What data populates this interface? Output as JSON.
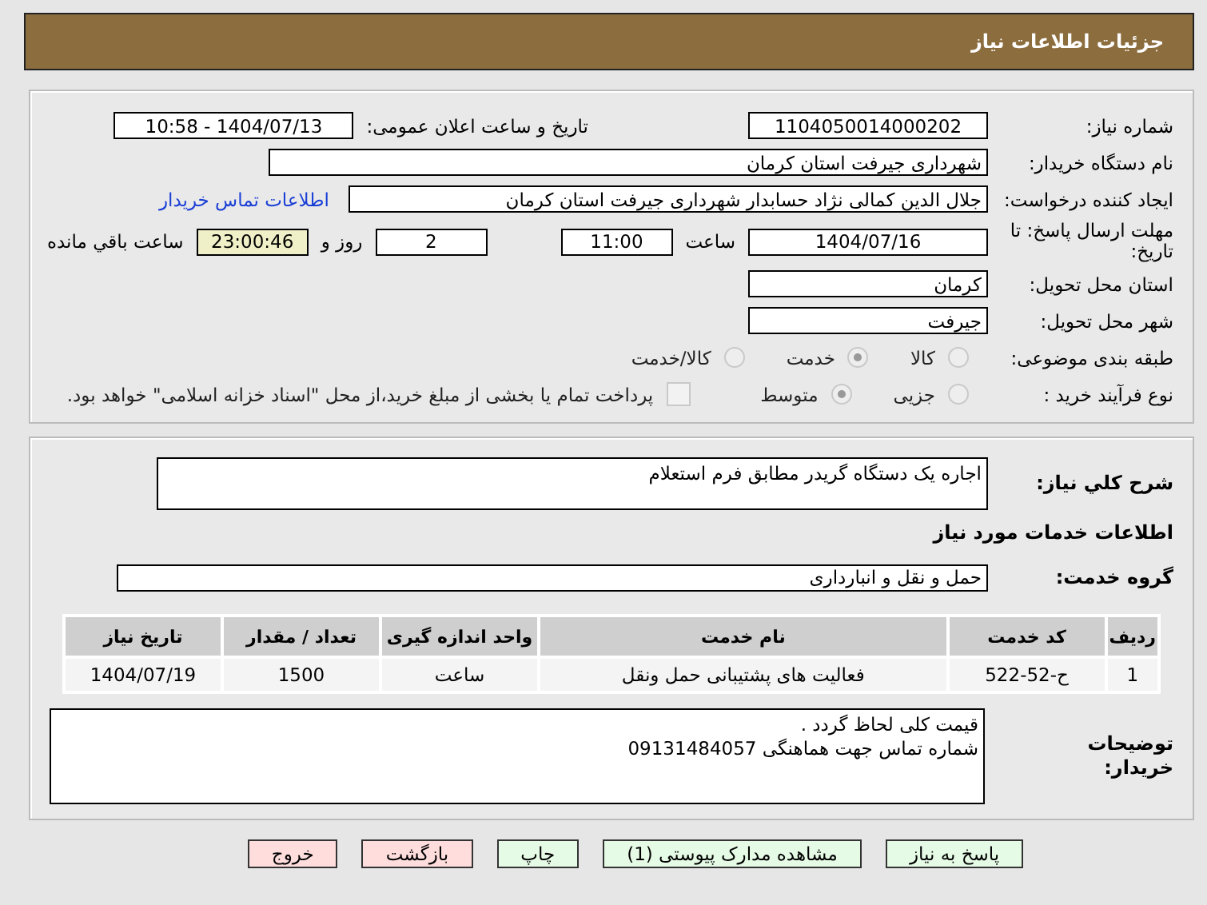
{
  "header": {
    "title": "جزئیات اطلاعات نیاز"
  },
  "need_number": {
    "label": "شماره نیاز:",
    "value": "1104050014000202"
  },
  "announce": {
    "label": "تاریخ و ساعت اعلان عمومی:",
    "value": "1404/07/13 - 10:58"
  },
  "buyer_org": {
    "label": "نام دستگاه خریدار:",
    "value": "شهرداری جیرفت استان کرمان"
  },
  "creator": {
    "label": "ایجاد کننده درخواست:",
    "value": "جلال الدین کمالی نژاد حسابدار شهرداری جیرفت استان کرمان",
    "link": "اطلاعات تماس خریدار"
  },
  "deadline": {
    "label": "مهلت ارسال پاسخ: تا تاریخ:",
    "date": "1404/07/16",
    "time_label": "ساعت",
    "time": "11:00",
    "days": "2",
    "days_label": "روز و",
    "remaining": "23:00:46",
    "remaining_label": "ساعت باقي مانده"
  },
  "province": {
    "label": "استان محل تحویل:",
    "value": "کرمان"
  },
  "city": {
    "label": "شهر محل تحویل:",
    "value": "جیرفت"
  },
  "category": {
    "label": "طبقه بندی موضوعی:",
    "options": [
      {
        "label": "کالا",
        "selected": false
      },
      {
        "label": "خدمت",
        "selected": true
      },
      {
        "label": "کالا/خدمت",
        "selected": false
      }
    ]
  },
  "purchase_type": {
    "label": "نوع فرآیند خرید :",
    "options": [
      {
        "label": "جزیی",
        "selected": false
      },
      {
        "label": "متوسط",
        "selected": true
      }
    ],
    "treasury": {
      "label": "پرداخت تمام یا بخشی از مبلغ خرید،از محل \"اسناد خزانه اسلامی\" خواهد بود.",
      "checked": false
    }
  },
  "description": {
    "label": "شرح کلي نياز:",
    "value": "اجاره یک دستگاه گریدر مطابق فرم استعلام"
  },
  "services_title": "اطلاعات خدمات مورد نیاز",
  "service_group": {
    "label": "گروه خدمت:",
    "value": "حمل و نقل و انبارداری"
  },
  "table": {
    "columns": [
      "ردیف",
      "کد خدمت",
      "نام خدمت",
      "واحد اندازه گیری",
      "تعداد / مقدار",
      "تاریخ نیاز"
    ],
    "rows": [
      [
        "1",
        "ح-52-522",
        "فعالیت های پشتیبانی حمل ونقل",
        "ساعت",
        "1500",
        "1404/07/19"
      ]
    ]
  },
  "buyer_notes": {
    "label": "توضیحات خریدار:",
    "lines": [
      "قیمت کلی لحاظ گردد .",
      "شماره تماس جهت هماهنگی 09131484057"
    ]
  },
  "buttons": [
    {
      "label": "پاسخ به نیاز",
      "kind": "green"
    },
    {
      "label": "مشاهده مدارک پیوستی (1)",
      "kind": "green"
    },
    {
      "label": "چاپ",
      "kind": "green"
    },
    {
      "label": "بازگشت",
      "kind": "red"
    },
    {
      "label": "خروج",
      "kind": "red"
    }
  ]
}
